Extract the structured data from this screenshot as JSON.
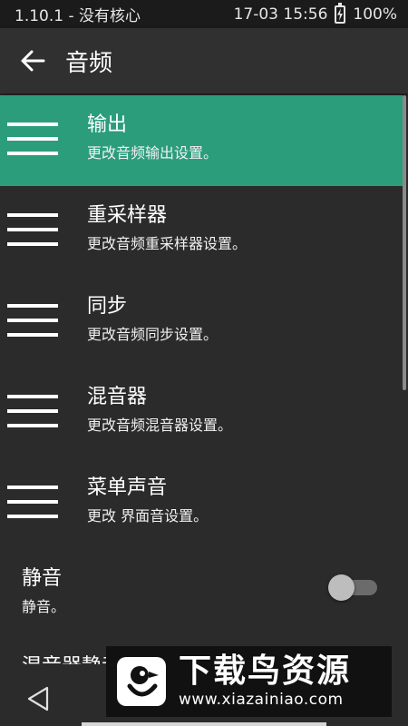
{
  "status_bar": {
    "left_text": "1.10.1 - 没有核心",
    "datetime": "17-03 15:56",
    "battery_percent": "100%",
    "battery_icon": "battery-charging-icon"
  },
  "app_bar": {
    "title": "音频",
    "back_icon": "arrow-left-icon"
  },
  "items": [
    {
      "title": "输出",
      "subtitle": "更改音频输出设置。",
      "icon": "menu-lines-icon",
      "selected": true
    },
    {
      "title": "重采样器",
      "subtitle": "更改音频重采样器设置。",
      "icon": "menu-lines-icon",
      "selected": false
    },
    {
      "title": "同步",
      "subtitle": "更改音频同步设置。",
      "icon": "menu-lines-icon",
      "selected": false
    },
    {
      "title": "混音器",
      "subtitle": "更改音频混音器设置。",
      "icon": "menu-lines-icon",
      "selected": false
    },
    {
      "title": "菜单声音",
      "subtitle": "更改 界面音设置。",
      "icon": "menu-lines-icon",
      "selected": false
    }
  ],
  "mute": {
    "title": "静音",
    "subtitle": "静音。",
    "enabled": false
  },
  "partial_item": {
    "title": "混音器静音"
  },
  "nav_bar": {
    "back_icon": "triangle-back-icon"
  },
  "watermark": {
    "brand": "下载鸟资源",
    "url": "www.xiazainiao.com",
    "logo_icon": "bird-logo-icon"
  },
  "colors": {
    "accent": "#2c9d7b",
    "background": "#2b2b2b",
    "app_bar": "#303030",
    "status_bar": "#1b1b1b"
  }
}
